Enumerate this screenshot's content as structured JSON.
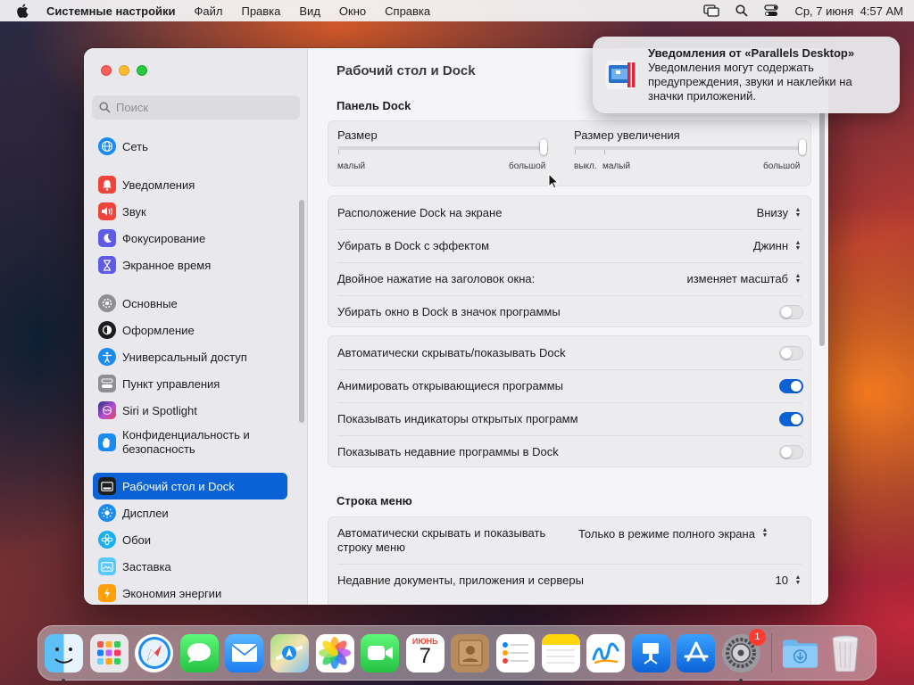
{
  "menubar": {
    "app_name": "Системные настройки",
    "items": [
      "Файл",
      "Правка",
      "Вид",
      "Окно",
      "Справка"
    ],
    "clock": "Ср, 7 июня  4:57 AM"
  },
  "sidebar": {
    "search_placeholder": "Поиск",
    "items": [
      {
        "label": "Сеть",
        "icon": "globe-icon",
        "color": "#1a8bf0"
      },
      {
        "label": "Уведомления",
        "icon": "bell-icon",
        "color": "#f0433a"
      },
      {
        "label": "Звук",
        "icon": "speaker-icon",
        "color": "#f0433a"
      },
      {
        "label": "Фокусирование",
        "icon": "moon-icon",
        "color": "#5e5ce6"
      },
      {
        "label": "Экранное время",
        "icon": "hourglass-icon",
        "color": "#5e5ce6"
      },
      {
        "label": "Основные",
        "icon": "gear-icon",
        "color": "#8e8e93"
      },
      {
        "label": "Оформление",
        "icon": "appearance-icon",
        "color": "#1d1d1f"
      },
      {
        "label": "Универсальный доступ",
        "icon": "accessibility-icon",
        "color": "#1a8bf0"
      },
      {
        "label": "Пункт управления",
        "icon": "control-center-icon",
        "color": "#8e8e93"
      },
      {
        "label": "Siri и Spotlight",
        "icon": "siri-icon",
        "color": "#b44fd6"
      },
      {
        "label": "Конфиденциальность и безопасность",
        "icon": "hand-icon",
        "color": "#1a8bf0"
      },
      {
        "label": "Рабочий стол и Dock",
        "icon": "dock-icon",
        "color": "#1d1d1f"
      },
      {
        "label": "Дисплеи",
        "icon": "sun-icon",
        "color": "#1a8bf0"
      },
      {
        "label": "Обои",
        "icon": "flower-icon",
        "color": "#1ab0f0"
      },
      {
        "label": "Заставка",
        "icon": "screensaver-icon",
        "color": "#5ac8fa"
      },
      {
        "label": "Экономия энергии",
        "icon": "battery-icon",
        "color": "#ff9f0a"
      }
    ]
  },
  "content": {
    "title": "Рабочий стол и Dock",
    "dock_section": "Панель Dock",
    "size": {
      "label": "Размер",
      "min": "малый",
      "max": "большой",
      "value": 0.98
    },
    "magnification": {
      "label": "Размер увеличения",
      "off": "выкл.",
      "min": "малый",
      "max": "большой",
      "value": 1.0
    },
    "rows1": [
      {
        "label": "Расположение Dock на экране",
        "value": "Внизу"
      },
      {
        "label": "Убирать в Dock с эффектом",
        "value": "Джинн"
      },
      {
        "label": "Двойное нажатие на заголовок окна:",
        "value": "изменяет масштаб"
      },
      {
        "label": "Убирать окно в Dock в значок программы",
        "toggle": false
      }
    ],
    "rows2": [
      {
        "label": "Автоматически скрывать/показывать Dock",
        "toggle": false
      },
      {
        "label": "Анимировать открывающиеся программы",
        "toggle": true
      },
      {
        "label": "Показывать индикаторы открытых программ",
        "toggle": true
      },
      {
        "label": "Показывать недавние программы в Dock",
        "toggle": false
      }
    ],
    "menu_section": "Строка меню",
    "menu_rows": [
      {
        "label": "Автоматически скрывать и показывать строку меню",
        "value": "Только в режиме полного экрана"
      },
      {
        "label": "Недавние документы, приложения и серверы",
        "value": "10"
      }
    ]
  },
  "notification": {
    "title": "Уведомления от «Parallels Desktop»",
    "body": "Уведомления могут содержать предупреждения, звуки и наклейки на значки приложений."
  },
  "dock": {
    "calendar_month": "ИЮНЬ",
    "calendar_day": "7",
    "settings_badge": "1"
  }
}
